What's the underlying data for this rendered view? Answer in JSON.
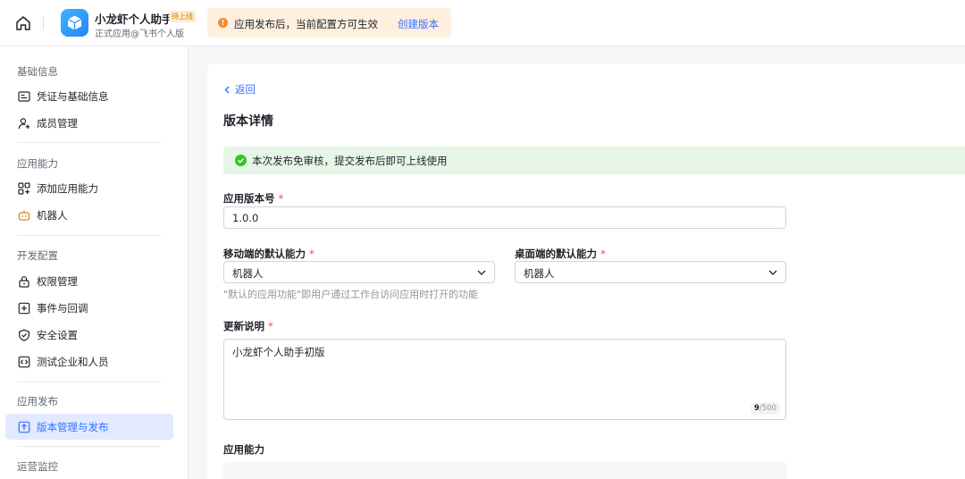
{
  "topbar": {
    "app_name": "小龙虾个人助手",
    "app_badge": "待上线",
    "app_sub": "正式应用@飞书个人版",
    "notice_text": "应用发布后，当前配置方可生效",
    "notice_link": "创建版本"
  },
  "sidebar": {
    "sections": [
      {
        "title": "基础信息",
        "items": [
          {
            "label": "凭证与基础信息",
            "icon": "credential-card-icon"
          },
          {
            "label": "成员管理",
            "icon": "add-member-icon"
          }
        ]
      },
      {
        "title": "应用能力",
        "items": [
          {
            "label": "添加应用能力",
            "icon": "add-grid-icon"
          },
          {
            "label": "机器人",
            "icon": "robot-icon"
          }
        ]
      },
      {
        "title": "开发配置",
        "items": [
          {
            "label": "权限管理",
            "icon": "lock-icon"
          },
          {
            "label": "事件与回调",
            "icon": "event-icon"
          },
          {
            "label": "安全设置",
            "icon": "shield-icon"
          },
          {
            "label": "测试企业和人员",
            "icon": "code-icon"
          }
        ]
      },
      {
        "title": "应用发布",
        "items": [
          {
            "label": "版本管理与发布",
            "icon": "upload-icon",
            "active": true
          }
        ]
      },
      {
        "title": "运营监控",
        "items": []
      }
    ]
  },
  "main": {
    "back_label": "返回",
    "title": "版本详情",
    "success_text": "本次发布免审核，提交发布后即可上线使用",
    "version": {
      "label": "应用版本号",
      "required": "*",
      "value": "1.0.0"
    },
    "mobile_default": {
      "label": "移动端的默认能力",
      "required": "*",
      "value": "机器人"
    },
    "desktop_default": {
      "label": "桌面端的默认能力",
      "required": "*",
      "value": "机器人"
    },
    "default_hint": "\"默认的应用功能\"即用户通过工作台访问应用时打开的功能",
    "release_notes": {
      "label": "更新说明",
      "required": "*",
      "value": "小龙虾个人助手初版",
      "count": "9",
      "max": "/500"
    },
    "capability_label": "应用能力"
  },
  "colors": {
    "accent": "#3370ff",
    "success": "#34c724",
    "warning": "#f5892d",
    "required": "#f54a45"
  }
}
